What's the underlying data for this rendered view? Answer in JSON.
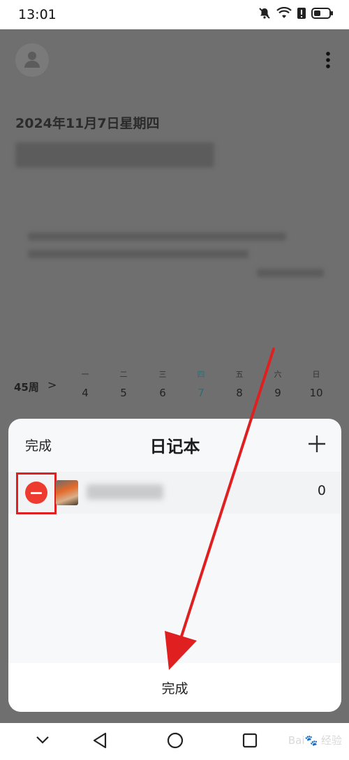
{
  "status_bar": {
    "time": "13:01",
    "icons": [
      "bell-off-icon",
      "wifi-icon",
      "alert-icon",
      "battery-icon"
    ]
  },
  "background": {
    "date_heading": "2024年11月7日星期四"
  },
  "week_strip": {
    "week_label": "45周",
    "next_symbol": ">",
    "days": [
      {
        "name": "一",
        "num": "4"
      },
      {
        "name": "二",
        "num": "5"
      },
      {
        "name": "三",
        "num": "6"
      },
      {
        "name": "四",
        "num": "7"
      },
      {
        "name": "五",
        "num": "8"
      },
      {
        "name": "六",
        "num": "9"
      },
      {
        "name": "日",
        "num": "10"
      }
    ]
  },
  "sheet": {
    "done_top": "完成",
    "title": "日记本",
    "add_icon": "plus-icon",
    "notebook": {
      "count": "0"
    },
    "done_bottom": "完成"
  },
  "nav": {
    "icons": [
      "chevron-down-icon",
      "back-icon",
      "home-icon",
      "recents-icon"
    ]
  },
  "annotation": {
    "highlight_color": "#e02020",
    "arrow_color": "#e02020"
  }
}
